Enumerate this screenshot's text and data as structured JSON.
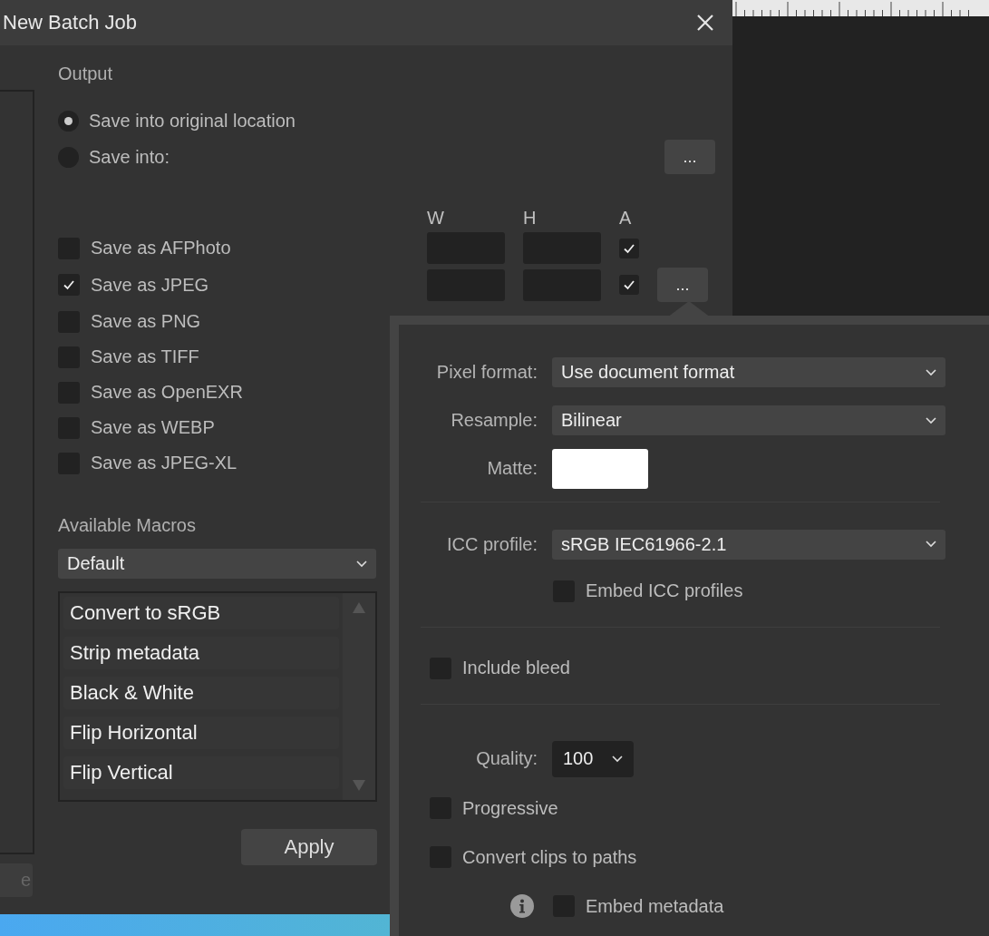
{
  "window": {
    "title": "New Batch Job"
  },
  "left_button": {
    "label": "e"
  },
  "output": {
    "heading": "Output",
    "destinations": [
      {
        "label": "Save into original location",
        "selected": true
      },
      {
        "label": "Save into:",
        "selected": false,
        "browse": "..."
      }
    ]
  },
  "size_headers": [
    "W",
    "H",
    "A"
  ],
  "formats": [
    {
      "label": "Save as AFPhoto",
      "checked": false,
      "size": {
        "alpha": true
      }
    },
    {
      "label": "Save as JPEG",
      "checked": true,
      "size": {
        "alpha": true
      },
      "options": "..."
    },
    {
      "label": "Save as PNG",
      "checked": false
    },
    {
      "label": "Save as TIFF",
      "checked": false
    },
    {
      "label": "Save as OpenEXR",
      "checked": false
    },
    {
      "label": "Save as WEBP",
      "checked": false
    },
    {
      "label": "Save as JPEG-XL",
      "checked": false
    }
  ],
  "macros": {
    "heading": "Available Macros",
    "set": "Default",
    "items": [
      "Convert to sRGB",
      "Strip metadata",
      "Black & White",
      "Flip Horizontal",
      "Flip Vertical"
    ],
    "apply": "Apply"
  },
  "popover": {
    "rows": [
      {
        "kind": "select",
        "label": "Pixel format:",
        "value": "Use document format"
      },
      {
        "kind": "select",
        "label": "Resample:",
        "value": "Bilinear"
      },
      {
        "kind": "swatch",
        "label": "Matte:",
        "color": "#ffffff"
      },
      {
        "kind": "divider"
      },
      {
        "kind": "select",
        "label": "ICC profile:",
        "value": "sRGB IEC61966-2.1"
      },
      {
        "kind": "subcheck",
        "label": "Embed ICC profiles",
        "checked": false
      },
      {
        "kind": "divider"
      },
      {
        "kind": "check",
        "label": "Include bleed",
        "checked": false
      },
      {
        "kind": "divider"
      },
      {
        "kind": "quality",
        "label": "Quality:",
        "value": "100"
      },
      {
        "kind": "check",
        "label": "Progressive",
        "checked": false
      },
      {
        "kind": "check",
        "label": "Convert clips to paths",
        "checked": false
      },
      {
        "kind": "infocheck",
        "label": "Embed metadata",
        "checked": false
      }
    ]
  }
}
